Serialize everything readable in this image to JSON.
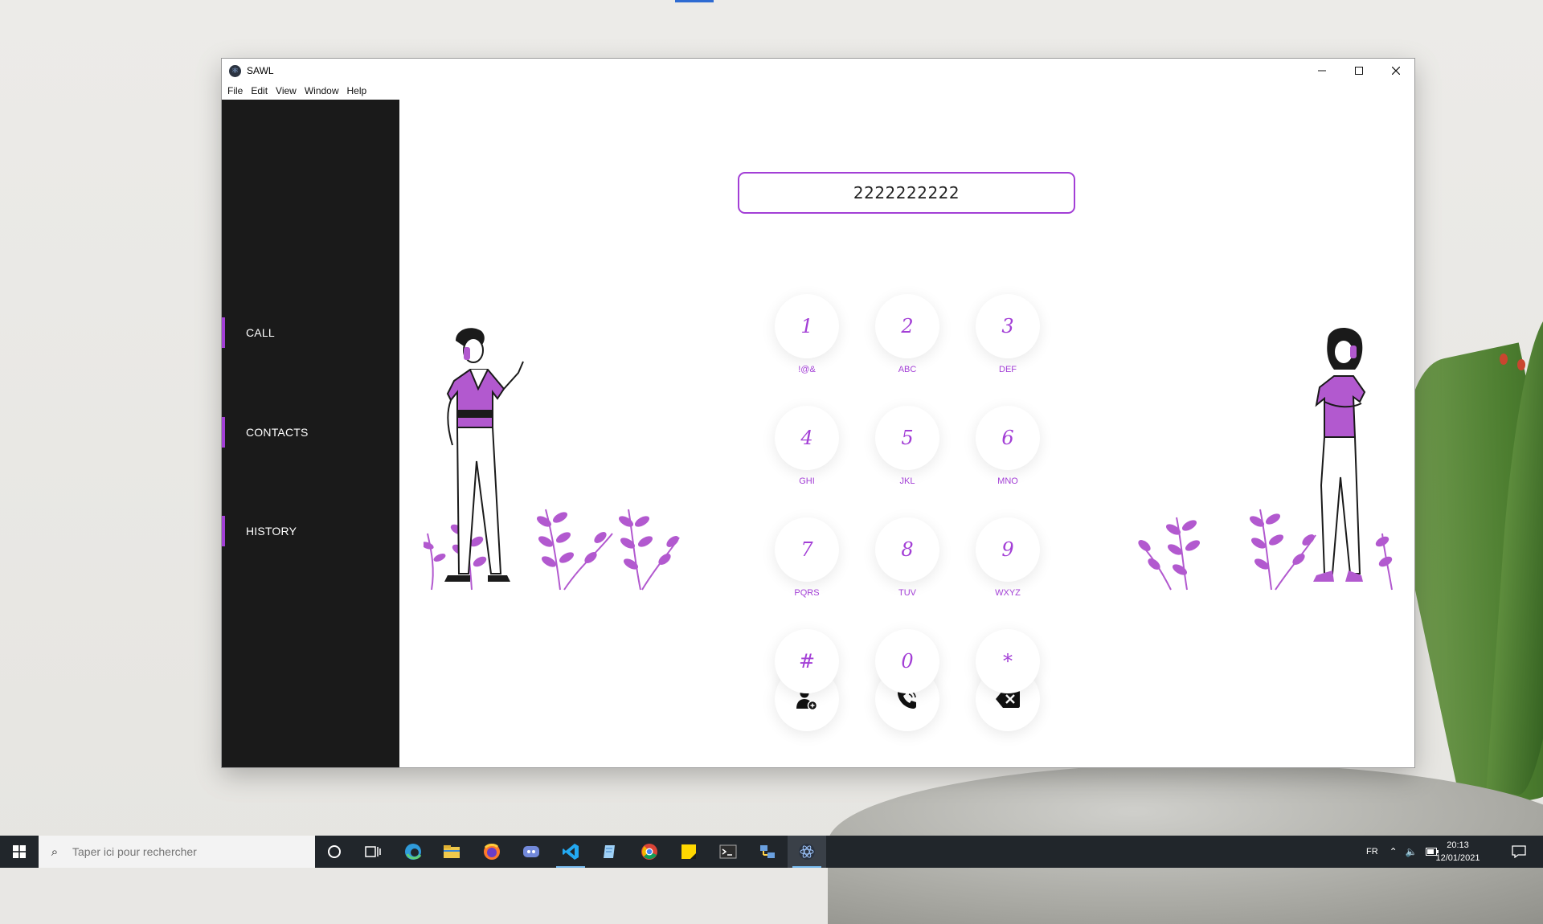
{
  "window": {
    "title": "SAWL",
    "menu": [
      "File",
      "Edit",
      "View",
      "Window",
      "Help"
    ]
  },
  "sidebar": {
    "items": [
      {
        "label": "CALL"
      },
      {
        "label": "CONTACTS"
      },
      {
        "label": "HISTORY"
      }
    ]
  },
  "dialer": {
    "number": "2222222222",
    "keys": [
      {
        "digit": "1",
        "letters": "!@&"
      },
      {
        "digit": "2",
        "letters": "ABC"
      },
      {
        "digit": "3",
        "letters": "DEF"
      },
      {
        "digit": "4",
        "letters": "GHI"
      },
      {
        "digit": "5",
        "letters": "JKL"
      },
      {
        "digit": "6",
        "letters": "MNO"
      },
      {
        "digit": "7",
        "letters": "PQRS"
      },
      {
        "digit": "8",
        "letters": "TUV"
      },
      {
        "digit": "9",
        "letters": "WXYZ"
      },
      {
        "digit": "#",
        "letters": ""
      },
      {
        "digit": "0",
        "letters": ""
      },
      {
        "digit": "*",
        "letters": ""
      }
    ],
    "actions": {
      "add_contact_icon": "add-contact-icon",
      "call_icon": "phone-call-icon",
      "backspace_icon": "backspace-icon"
    }
  },
  "colors": {
    "accent": "#a33fd6",
    "sidebar_bg": "#1a1a1a",
    "taskbar_bg": "#21262b"
  },
  "taskbar": {
    "search_placeholder": "Taper ici pour rechercher",
    "language": "FR",
    "time": "20:13",
    "date": "12/01/2021"
  }
}
